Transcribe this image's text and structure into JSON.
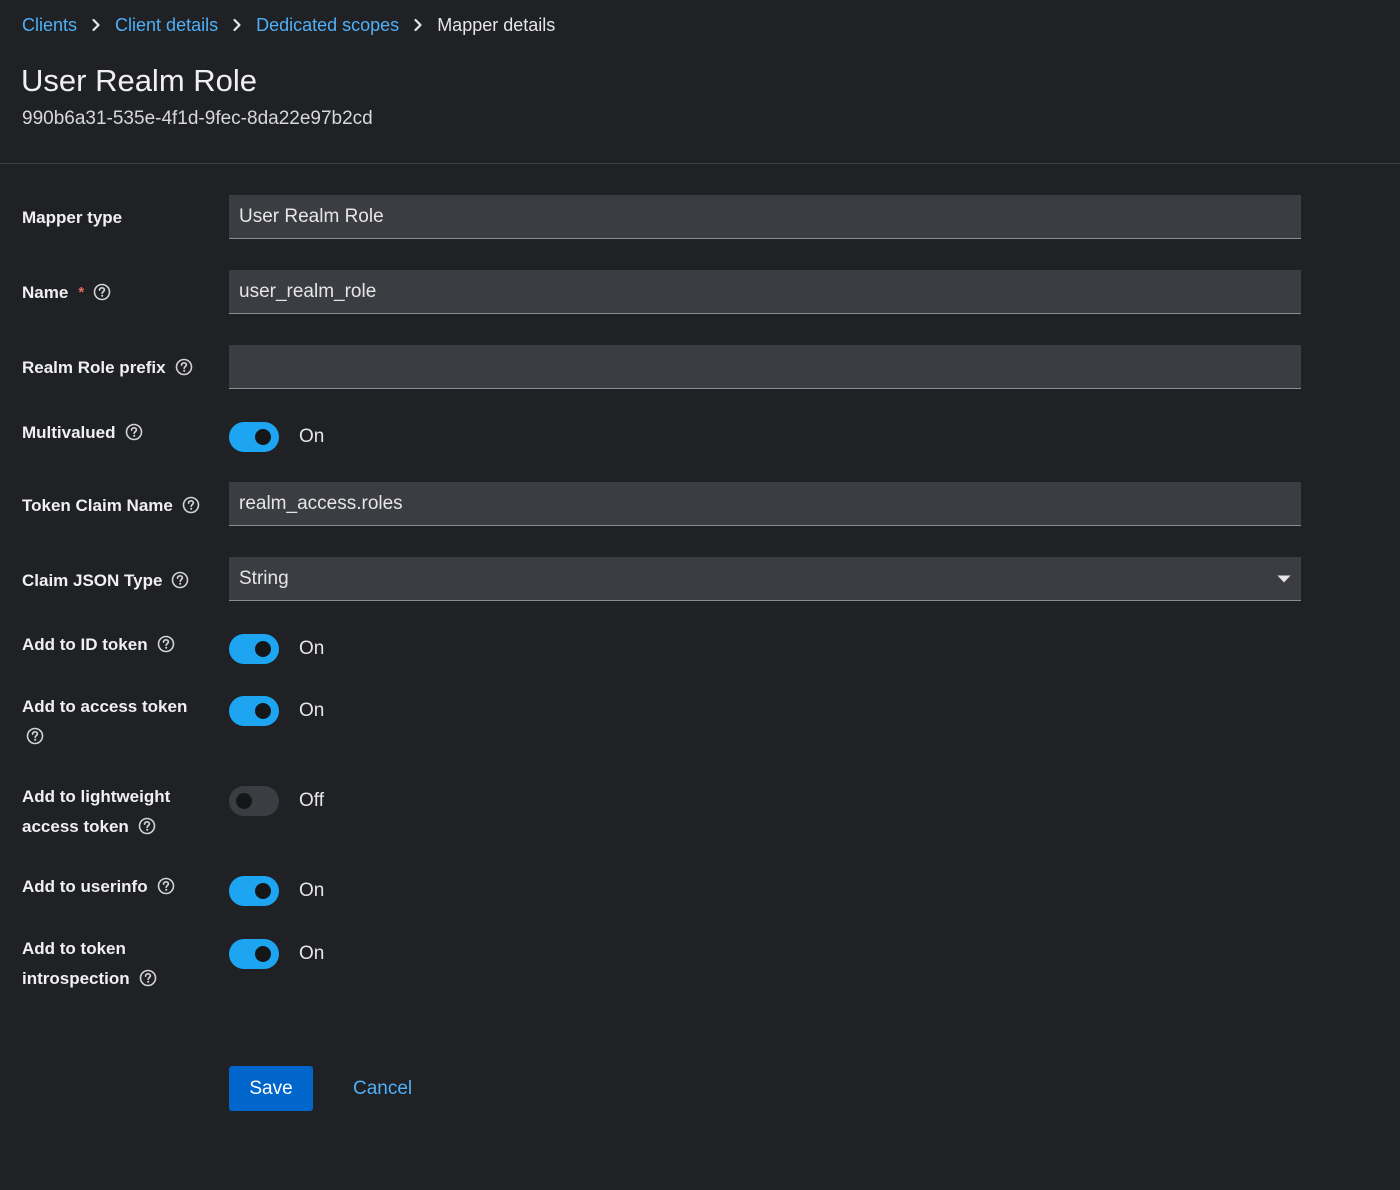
{
  "breadcrumb": {
    "items": [
      {
        "label": "Clients"
      },
      {
        "label": "Client details"
      },
      {
        "label": "Dedicated scopes"
      }
    ],
    "current": "Mapper details"
  },
  "header": {
    "title": "User Realm Role",
    "subtitle": "990b6a31-535e-4f1d-9fec-8da22e97b2cd"
  },
  "form": {
    "mapper_type": {
      "label": "Mapper type",
      "value": "User Realm Role"
    },
    "name": {
      "label": "Name",
      "required_mark": "*",
      "value": "user_realm_role"
    },
    "realm_role_prefix": {
      "label": "Realm Role prefix",
      "value": ""
    },
    "multivalued": {
      "label": "Multivalued",
      "state": "On"
    },
    "token_claim_name": {
      "label": "Token Claim Name",
      "value": "realm_access.roles"
    },
    "claim_json_type": {
      "label": "Claim JSON Type",
      "value": "String"
    },
    "add_to_id_token": {
      "label": "Add to ID token",
      "state": "On"
    },
    "add_to_access_token": {
      "label": "Add to access token",
      "state": "On"
    },
    "add_to_lightweight_access_token": {
      "label_line1": "Add to lightweight",
      "label_line2": "access token",
      "state": "Off"
    },
    "add_to_userinfo": {
      "label": "Add to userinfo",
      "state": "On"
    },
    "add_to_token_introspection": {
      "label_line1": "Add to token",
      "label_line2": "introspection",
      "state": "On"
    }
  },
  "actions": {
    "save_label": "Save",
    "cancel_label": "Cancel"
  },
  "colors": {
    "background": "#1f2125",
    "link": "#4fb0f7",
    "switch_on": "#1ea5f2",
    "switch_off": "#3b3d43",
    "primary_button": "#0066cc",
    "required": "#e86f5d"
  },
  "icons": {
    "breadcrumb_separator": "chevron-right-icon",
    "help": "question-circle-icon",
    "select_caret": "caret-down-icon"
  }
}
